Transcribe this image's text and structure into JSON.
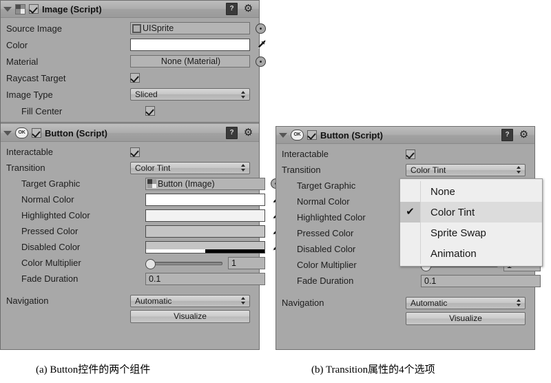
{
  "panel_a": {
    "components": [
      {
        "header": {
          "title": "Image (Script)",
          "icon": "image-component-icon",
          "enabled_checkbox": true,
          "help_icon": "?",
          "gear_icon": "⚙"
        },
        "rows": [
          {
            "label": "Source Image",
            "type": "object",
            "value": "UISprite",
            "thumb": "sprite-icon"
          },
          {
            "label": "Color",
            "type": "color",
            "value": "#FFFFFF",
            "alpha": 100
          },
          {
            "label": "Material",
            "type": "object",
            "value": "None (Material)",
            "thumb": "none"
          },
          {
            "label": "Raycast Target",
            "type": "checkbox",
            "value": true
          },
          {
            "label": "Image Type",
            "type": "popup",
            "value": "Sliced"
          },
          {
            "label": "Fill Center",
            "type": "checkbox",
            "value": true,
            "indent": true
          }
        ]
      },
      {
        "header": {
          "title": "Button (Script)",
          "icon": "script-ok-icon",
          "icon_text": "OK",
          "enabled_checkbox": true,
          "help_icon": "?",
          "gear_icon": "⚙"
        },
        "rows": [
          {
            "label": "Interactable",
            "type": "checkbox",
            "value": true
          },
          {
            "label": "Transition",
            "type": "popup",
            "value": "Color Tint"
          },
          {
            "label": "Target Graphic",
            "type": "object",
            "value": "Button (Image)",
            "thumb": "checker-icon",
            "indent": true
          },
          {
            "label": "Normal Color",
            "type": "color",
            "value": "#FFFFFF",
            "alpha": 100,
            "indent": true
          },
          {
            "label": "Highlighted Color",
            "type": "color",
            "value": "#F5F5F5",
            "alpha": 100,
            "indent": true
          },
          {
            "label": "Pressed Color",
            "type": "color",
            "value": "#C8C8C8",
            "alpha": 100,
            "indent": true
          },
          {
            "label": "Disabled Color",
            "type": "color",
            "value": "#C8C8C8",
            "alpha": 50,
            "indent": true
          },
          {
            "label": "Color Multiplier",
            "type": "slider",
            "value": "1",
            "slider_pos": 0,
            "indent": true
          },
          {
            "label": "Fade Duration",
            "type": "number",
            "value": "0.1",
            "indent": true
          },
          {
            "label": "Navigation",
            "type": "popup",
            "value": "Automatic"
          },
          {
            "label": "",
            "type": "button",
            "value": "Visualize"
          }
        ]
      }
    ]
  },
  "panel_b": {
    "components": [
      {
        "header": {
          "title": "Button (Script)",
          "icon": "script-ok-icon",
          "icon_text": "OK",
          "enabled_checkbox": true,
          "help_icon": "?",
          "gear_icon": "⚙"
        },
        "rows": [
          {
            "label": "Interactable",
            "type": "checkbox",
            "value": true
          },
          {
            "label": "Transition",
            "type": "popup",
            "value": "Color Tint"
          },
          {
            "label": "Target Graphic",
            "type": "hidden",
            "value": "",
            "indent": true
          },
          {
            "label": "Normal Color",
            "type": "hidden",
            "value": "",
            "indent": true
          },
          {
            "label": "Highlighted Color",
            "type": "hidden",
            "value": "",
            "indent": true
          },
          {
            "label": "Pressed Color",
            "type": "hidden",
            "value": "",
            "indent": true
          },
          {
            "label": "Disabled Color",
            "type": "hidden",
            "value": "",
            "indent": true
          },
          {
            "label": "Color Multiplier",
            "type": "slider",
            "value": "1",
            "slider_pos": 0,
            "indent": true
          },
          {
            "label": "Fade Duration",
            "type": "number",
            "value": "0.1",
            "indent": true
          },
          {
            "label": "Navigation",
            "type": "popup",
            "value": "Automatic"
          },
          {
            "label": "",
            "type": "button",
            "value": "Visualize"
          }
        ]
      }
    ],
    "dropdown": {
      "name": "transition-dropdown",
      "selected": "Color Tint",
      "check_glyph": "✔",
      "options": [
        "None",
        "Color Tint",
        "Sprite Swap",
        "Animation"
      ]
    }
  },
  "captions": {
    "a": "(a) Button控件的两个组件",
    "b": "(b) Transition属性的4个选项"
  }
}
